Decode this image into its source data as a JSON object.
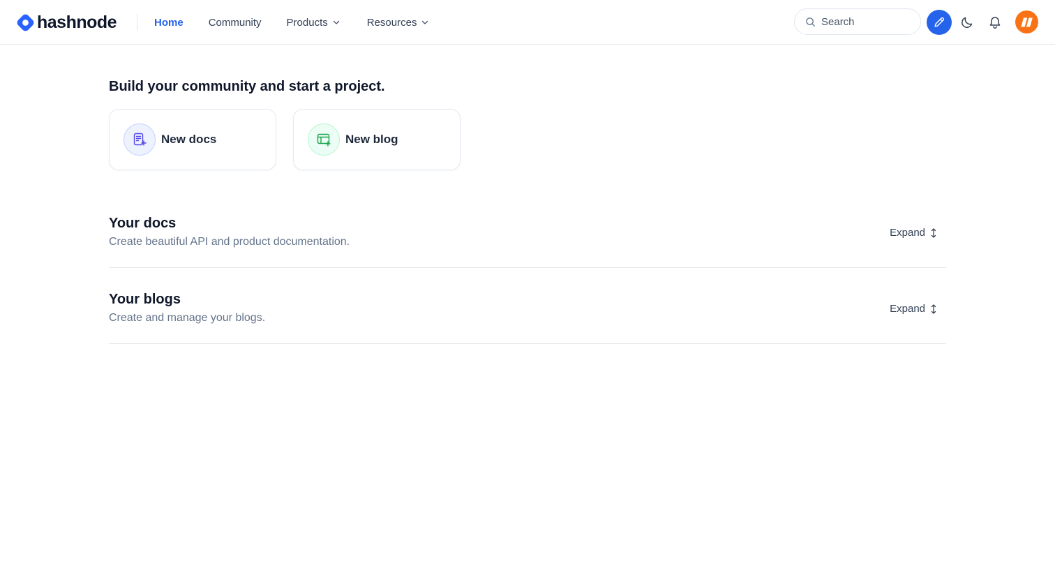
{
  "brand": {
    "name": "hashnode",
    "color": "#2962ff"
  },
  "nav": {
    "items": [
      {
        "label": "Home",
        "active": true,
        "has_dropdown": false
      },
      {
        "label": "Community",
        "active": false,
        "has_dropdown": false
      },
      {
        "label": "Products",
        "active": false,
        "has_dropdown": true
      },
      {
        "label": "Resources",
        "active": false,
        "has_dropdown": true
      }
    ]
  },
  "header": {
    "search": {
      "placeholder": "Search",
      "value": ""
    },
    "icons": [
      "search-icon",
      "pencil-icon",
      "moon-icon",
      "bell-icon",
      "avatar"
    ],
    "accent_color": "#2563eb",
    "avatar_color": "#f97316"
  },
  "main": {
    "headline": "Build your community and start a project.",
    "cards": [
      {
        "label": "New docs",
        "icon": "new-docs-icon",
        "color": "#4f46e5"
      },
      {
        "label": "New blog",
        "icon": "new-blog-icon",
        "color": "#16a34a"
      }
    ],
    "sections": [
      {
        "title": "Your docs",
        "description": "Create beautiful API and product documentation.",
        "action": "Expand"
      },
      {
        "title": "Your blogs",
        "description": "Create and manage your blogs.",
        "action": "Expand"
      }
    ]
  }
}
